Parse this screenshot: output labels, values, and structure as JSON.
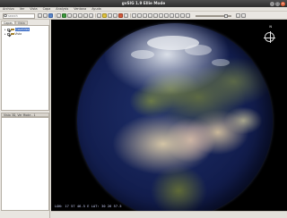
{
  "window": {
    "title": "gvSIG 1.9 Ellie Mode"
  },
  "menu": [
    "Archivo",
    "Ver",
    "Vista",
    "Capa",
    "Analysis",
    "Ventana",
    "Ayuda"
  ],
  "toolbar": {
    "search_placeholder": "search"
  },
  "sidebar": {
    "tabs": [
      "Capas",
      "Vista"
    ],
    "layers": [
      {
        "label": "Countries",
        "checked": true,
        "selected": true
      },
      {
        "label": "Vista",
        "checked": true,
        "selected": false
      }
    ],
    "lower_panel_title": "Vista 3D, Ver Mode - 1"
  },
  "viewport": {
    "compass_label": "N",
    "coords": "LON: 17 57 46.5 E   LAT: 30 26 57.5"
  }
}
